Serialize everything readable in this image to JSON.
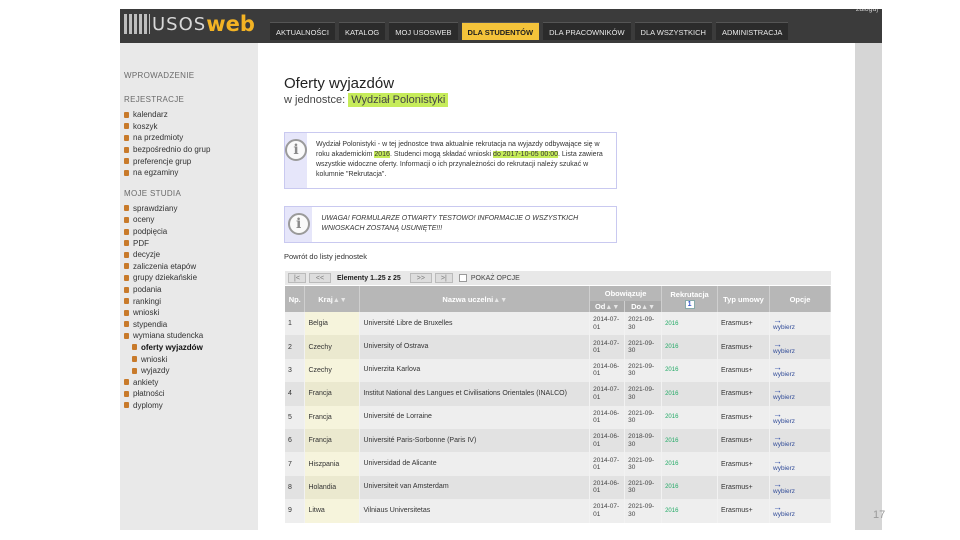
{
  "app": {
    "logo_left": "USOS",
    "logo_right": "web",
    "top_right": "zaloguj"
  },
  "nav": {
    "tabs": [
      "AKTUALNOŚCI",
      "KATALOG",
      "MOJ USOSWEB",
      "DLA STUDENTÓW",
      "DLA PRACOWNIKÓW",
      "DLA WSZYSTKICH",
      "ADMINISTRACJA"
    ],
    "active_index": 3
  },
  "sidebar": {
    "sections": [
      {
        "header": "WPROWADZENIE",
        "items": []
      },
      {
        "header": "REJESTRACJE",
        "items": [
          {
            "label": "kalendarz"
          },
          {
            "label": "koszyk"
          },
          {
            "label": "na przedmioty"
          },
          {
            "label": "bezpośrednio do grup"
          },
          {
            "label": "preferencje grup"
          },
          {
            "label": "na egzaminy"
          }
        ]
      },
      {
        "header": "MOJE STUDIA",
        "items": [
          {
            "label": "sprawdziany"
          },
          {
            "label": "oceny"
          },
          {
            "label": "podpięcia"
          },
          {
            "label": "PDF"
          },
          {
            "label": "decyzje"
          },
          {
            "label": "zaliczenia etapów"
          },
          {
            "label": "grupy dziekańskie"
          },
          {
            "label": "podania"
          },
          {
            "label": "rankingi"
          },
          {
            "label": "wnioski"
          },
          {
            "label": "stypendia"
          },
          {
            "label": "wymiana studencka"
          },
          {
            "label": "oferty wyjazdów",
            "sub": true,
            "current": true
          },
          {
            "label": "wnioski",
            "sub": true
          },
          {
            "label": "wyjazdy",
            "sub": true
          },
          {
            "label": "ankiety"
          },
          {
            "label": "płatności"
          },
          {
            "label": "dyplomy"
          }
        ]
      }
    ]
  },
  "main": {
    "title": "Oferty wyjazdów",
    "subtitle_prefix": "w jednostce:",
    "unit": "Wydział Polonistyki",
    "info1_a": "Wydział Polonistyki - w tej jednostce trwa aktualnie rekrutacja na wyjazdy odbywające się w roku akademickim ",
    "info1_year": "2016",
    "info1_b": ". Studenci mogą składać wnioski ",
    "info1_date": "do 2017-10-05 00:00",
    "info1_c": ". Lista zawiera wszystkie widoczne oferty. Informacji o ich przynależności do rekrutacji należy szukać w kolumnie \"Rekrutacja\".",
    "info2": "UWAGA! FORMULARZE OTWARTY TESTOWO! INFORMACJE O WSZYSTKICH WNIOSKACH ZOSTANĄ USUNIĘTE!!!",
    "back_link": "Powrót do listy jednostek"
  },
  "pager": {
    "first": "|<",
    "prev": "<<",
    "elements": "Elementy 1..25 z 25",
    "next": ">>",
    "last": ">|",
    "checkbox_label": "POKAŻ OPCJE"
  },
  "table": {
    "headers": {
      "np": "Np.",
      "kraj": "Kraj",
      "uczelnia": "Nazwa uczelni",
      "obowiazuje": "Obowiązuje",
      "od": "Od",
      "do": "Do",
      "rekrutacja": "Rekrutacja",
      "rekrutacja_num": "1",
      "typ": "Typ umowy",
      "opcje": "Opcje",
      "sort_mark": "▲▼"
    },
    "rows": [
      {
        "np": "1",
        "kraj": "Belgia",
        "uczelnia": "Université Libre de Bruxelles",
        "od": "2014-07-01",
        "do": "2021-09-30",
        "rek": "2016",
        "typ": "Erasmus+",
        "opcja": "wybierz"
      },
      {
        "np": "2",
        "kraj": "Czechy",
        "uczelnia": "University of Ostrava",
        "od": "2014-07-01",
        "do": "2021-09-30",
        "rek": "2016",
        "typ": "Erasmus+",
        "opcja": "wybierz"
      },
      {
        "np": "3",
        "kraj": "Czechy",
        "uczelnia": "Univerzita Karlova",
        "od": "2014-06-01",
        "do": "2021-09-30",
        "rek": "2016",
        "typ": "Erasmus+",
        "opcja": "wybierz"
      },
      {
        "np": "4",
        "kraj": "Francja",
        "uczelnia": "Institut National des Langues et Civilisations Orientales (INALCO)",
        "od": "2014-07-01",
        "do": "2021-09-30",
        "rek": "2016",
        "typ": "Erasmus+",
        "opcja": "wybierz"
      },
      {
        "np": "5",
        "kraj": "Francja",
        "uczelnia": "Université de Lorraine",
        "od": "2014-06-01",
        "do": "2021-09-30",
        "rek": "2016",
        "typ": "Erasmus+",
        "opcja": "wybierz"
      },
      {
        "np": "6",
        "kraj": "Francja",
        "uczelnia": "Université Paris-Sorbonne (Paris IV)",
        "od": "2014-06-01",
        "do": "2018-09-30",
        "rek": "2016",
        "typ": "Erasmus+",
        "opcja": "wybierz"
      },
      {
        "np": "7",
        "kraj": "Hiszpania",
        "uczelnia": "Universidad de Alicante",
        "od": "2014-07-01",
        "do": "2021-09-30",
        "rek": "2016",
        "typ": "Erasmus+",
        "opcja": "wybierz"
      },
      {
        "np": "8",
        "kraj": "Holandia",
        "uczelnia": "Universiteit van Amsterdam",
        "od": "2014-06-01",
        "do": "2021-09-30",
        "rek": "2016",
        "typ": "Erasmus+",
        "opcja": "wybierz"
      },
      {
        "np": "9",
        "kraj": "Litwa",
        "uczelnia": "Vilniaus Universitetas",
        "od": "2014-07-01",
        "do": "2021-09-30",
        "rek": "2016",
        "typ": "Erasmus+",
        "opcja": "wybierz"
      }
    ]
  },
  "slide_number": "17",
  "colors": {
    "highlight": "#c6ec5a",
    "active_tab": "#f4c33a",
    "topbar": "#3b3b3b"
  }
}
